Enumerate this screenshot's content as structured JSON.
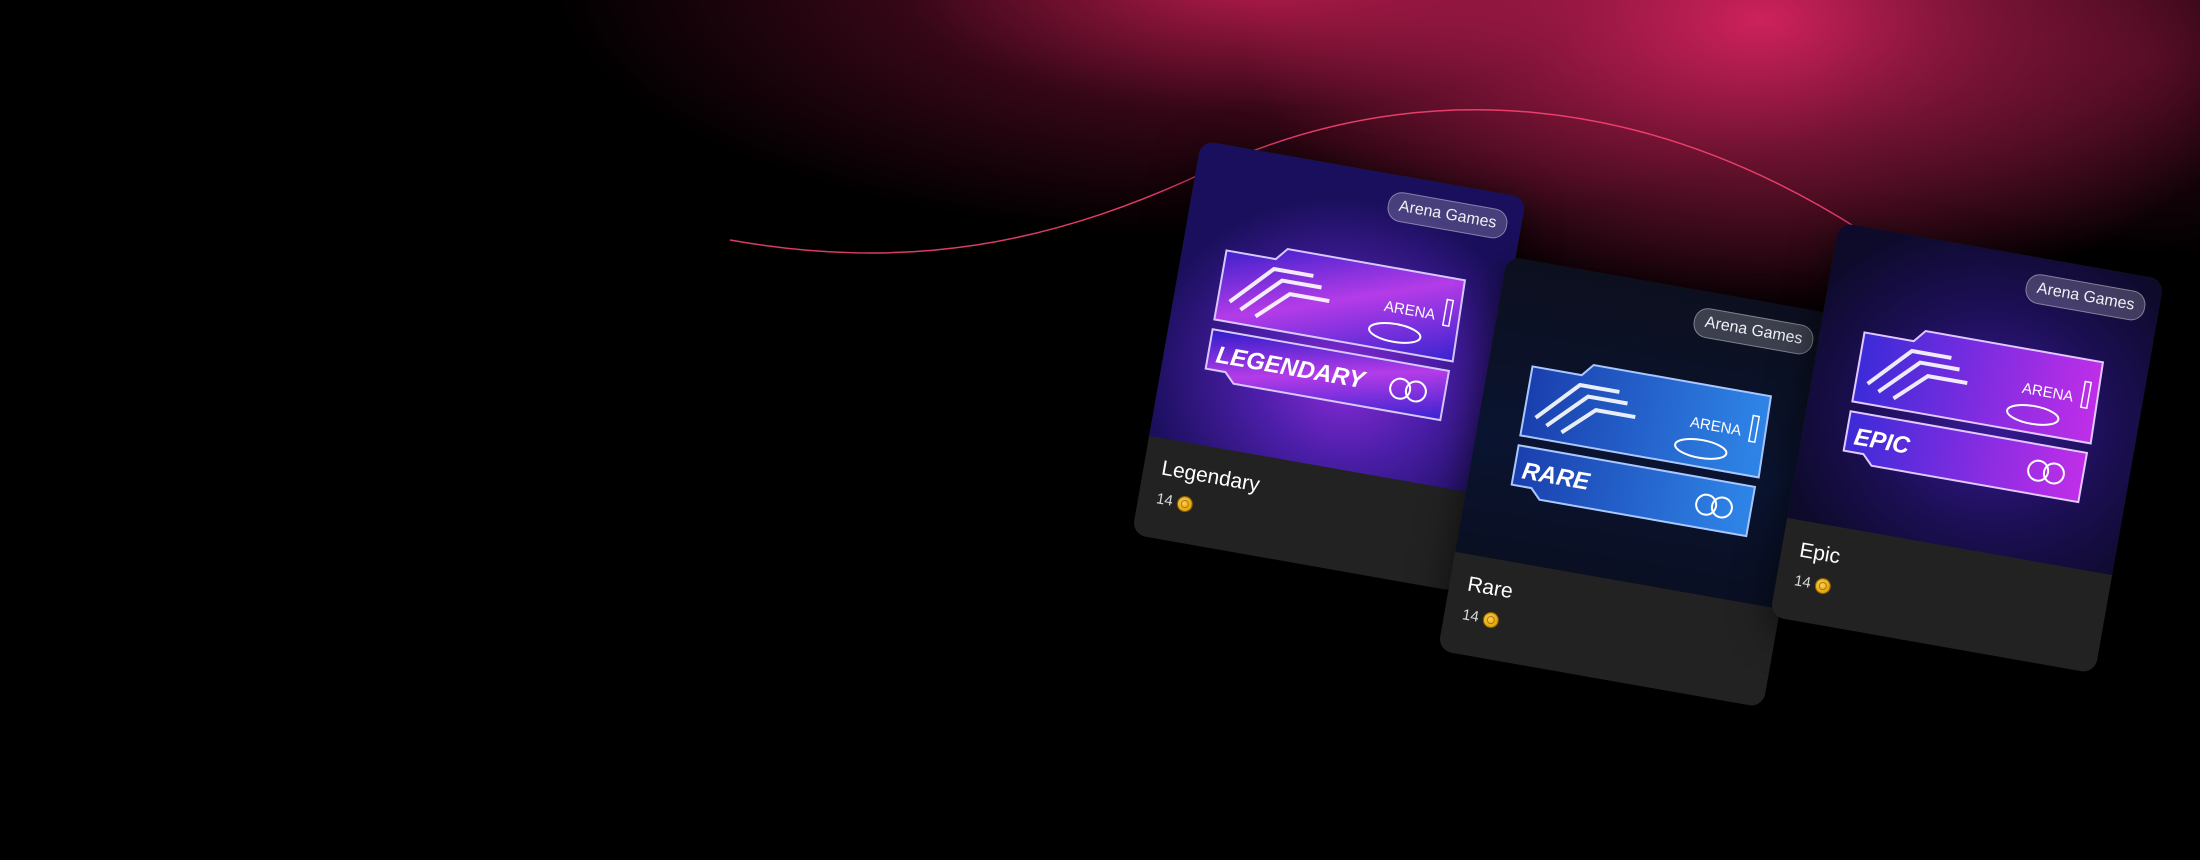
{
  "cards": [
    {
      "name": "Legendary",
      "price": "14",
      "badge": "Arena Games",
      "ticket_label": "LEGENDARY"
    },
    {
      "name": "Rare",
      "price": "14",
      "badge": "Arena Games",
      "ticket_label": "RARE"
    },
    {
      "name": "Epic",
      "price": "14",
      "badge": "Arena Games",
      "ticket_label": "EPIC"
    }
  ],
  "icons": {
    "currency": "coin-icon"
  },
  "colors": {
    "accent": "#d7235f",
    "card_bg": "#222223",
    "badge_bg": "#ffffff33"
  }
}
